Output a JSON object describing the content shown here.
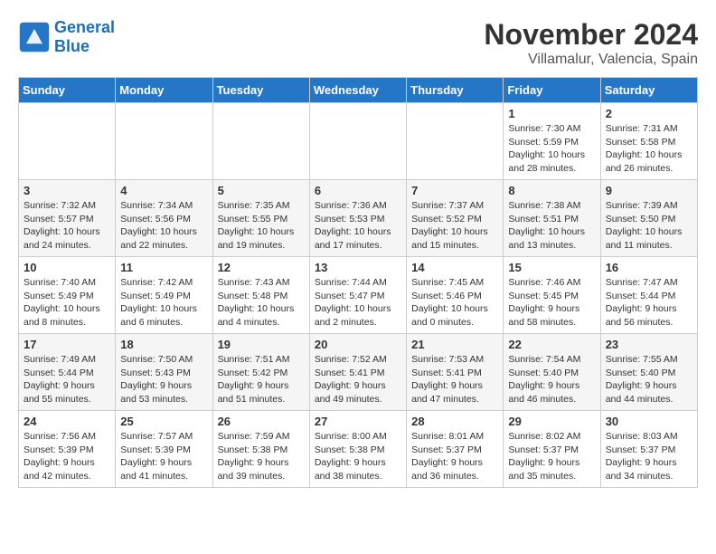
{
  "logo": {
    "line1": "General",
    "line2": "Blue"
  },
  "title": "November 2024",
  "location": "Villamalur, Valencia, Spain",
  "weekdays": [
    "Sunday",
    "Monday",
    "Tuesday",
    "Wednesday",
    "Thursday",
    "Friday",
    "Saturday"
  ],
  "weeks": [
    [
      {
        "day": "",
        "info": ""
      },
      {
        "day": "",
        "info": ""
      },
      {
        "day": "",
        "info": ""
      },
      {
        "day": "",
        "info": ""
      },
      {
        "day": "",
        "info": ""
      },
      {
        "day": "1",
        "info": "Sunrise: 7:30 AM\nSunset: 5:59 PM\nDaylight: 10 hours and 28 minutes."
      },
      {
        "day": "2",
        "info": "Sunrise: 7:31 AM\nSunset: 5:58 PM\nDaylight: 10 hours and 26 minutes."
      }
    ],
    [
      {
        "day": "3",
        "info": "Sunrise: 7:32 AM\nSunset: 5:57 PM\nDaylight: 10 hours and 24 minutes."
      },
      {
        "day": "4",
        "info": "Sunrise: 7:34 AM\nSunset: 5:56 PM\nDaylight: 10 hours and 22 minutes."
      },
      {
        "day": "5",
        "info": "Sunrise: 7:35 AM\nSunset: 5:55 PM\nDaylight: 10 hours and 19 minutes."
      },
      {
        "day": "6",
        "info": "Sunrise: 7:36 AM\nSunset: 5:53 PM\nDaylight: 10 hours and 17 minutes."
      },
      {
        "day": "7",
        "info": "Sunrise: 7:37 AM\nSunset: 5:52 PM\nDaylight: 10 hours and 15 minutes."
      },
      {
        "day": "8",
        "info": "Sunrise: 7:38 AM\nSunset: 5:51 PM\nDaylight: 10 hours and 13 minutes."
      },
      {
        "day": "9",
        "info": "Sunrise: 7:39 AM\nSunset: 5:50 PM\nDaylight: 10 hours and 11 minutes."
      }
    ],
    [
      {
        "day": "10",
        "info": "Sunrise: 7:40 AM\nSunset: 5:49 PM\nDaylight: 10 hours and 8 minutes."
      },
      {
        "day": "11",
        "info": "Sunrise: 7:42 AM\nSunset: 5:49 PM\nDaylight: 10 hours and 6 minutes."
      },
      {
        "day": "12",
        "info": "Sunrise: 7:43 AM\nSunset: 5:48 PM\nDaylight: 10 hours and 4 minutes."
      },
      {
        "day": "13",
        "info": "Sunrise: 7:44 AM\nSunset: 5:47 PM\nDaylight: 10 hours and 2 minutes."
      },
      {
        "day": "14",
        "info": "Sunrise: 7:45 AM\nSunset: 5:46 PM\nDaylight: 10 hours and 0 minutes."
      },
      {
        "day": "15",
        "info": "Sunrise: 7:46 AM\nSunset: 5:45 PM\nDaylight: 9 hours and 58 minutes."
      },
      {
        "day": "16",
        "info": "Sunrise: 7:47 AM\nSunset: 5:44 PM\nDaylight: 9 hours and 56 minutes."
      }
    ],
    [
      {
        "day": "17",
        "info": "Sunrise: 7:49 AM\nSunset: 5:44 PM\nDaylight: 9 hours and 55 minutes."
      },
      {
        "day": "18",
        "info": "Sunrise: 7:50 AM\nSunset: 5:43 PM\nDaylight: 9 hours and 53 minutes."
      },
      {
        "day": "19",
        "info": "Sunrise: 7:51 AM\nSunset: 5:42 PM\nDaylight: 9 hours and 51 minutes."
      },
      {
        "day": "20",
        "info": "Sunrise: 7:52 AM\nSunset: 5:41 PM\nDaylight: 9 hours and 49 minutes."
      },
      {
        "day": "21",
        "info": "Sunrise: 7:53 AM\nSunset: 5:41 PM\nDaylight: 9 hours and 47 minutes."
      },
      {
        "day": "22",
        "info": "Sunrise: 7:54 AM\nSunset: 5:40 PM\nDaylight: 9 hours and 46 minutes."
      },
      {
        "day": "23",
        "info": "Sunrise: 7:55 AM\nSunset: 5:40 PM\nDaylight: 9 hours and 44 minutes."
      }
    ],
    [
      {
        "day": "24",
        "info": "Sunrise: 7:56 AM\nSunset: 5:39 PM\nDaylight: 9 hours and 42 minutes."
      },
      {
        "day": "25",
        "info": "Sunrise: 7:57 AM\nSunset: 5:39 PM\nDaylight: 9 hours and 41 minutes."
      },
      {
        "day": "26",
        "info": "Sunrise: 7:59 AM\nSunset: 5:38 PM\nDaylight: 9 hours and 39 minutes."
      },
      {
        "day": "27",
        "info": "Sunrise: 8:00 AM\nSunset: 5:38 PM\nDaylight: 9 hours and 38 minutes."
      },
      {
        "day": "28",
        "info": "Sunrise: 8:01 AM\nSunset: 5:37 PM\nDaylight: 9 hours and 36 minutes."
      },
      {
        "day": "29",
        "info": "Sunrise: 8:02 AM\nSunset: 5:37 PM\nDaylight: 9 hours and 35 minutes."
      },
      {
        "day": "30",
        "info": "Sunrise: 8:03 AM\nSunset: 5:37 PM\nDaylight: 9 hours and 34 minutes."
      }
    ]
  ]
}
